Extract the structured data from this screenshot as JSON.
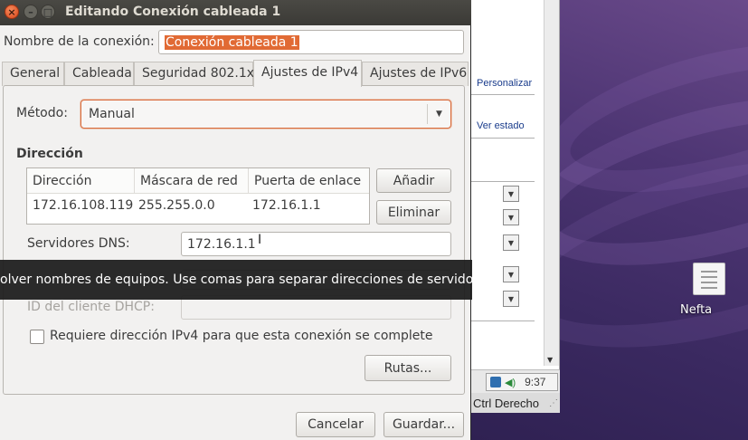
{
  "dialog": {
    "title": "Editando Conexión cableada 1",
    "connection_name_label": "Nombre de la conexión:",
    "connection_name_value": "Conexión cableada 1",
    "tabs": [
      {
        "label": "General"
      },
      {
        "label": "Cableada"
      },
      {
        "label": "Seguridad 802.1x"
      },
      {
        "label": "Ajustes de IPv4"
      },
      {
        "label": "Ajustes de IPv6"
      }
    ],
    "active_tab": "Ajustes de IPv4",
    "method_label": "Método:",
    "method_value": "Manual",
    "address_section_title": "Dirección",
    "address_table": {
      "columns": [
        "Dirección",
        "Máscara de red",
        "Puerta de enlace"
      ],
      "rows": [
        [
          "172.16.108.119",
          "255.255.0.0",
          "172.16.1.1"
        ]
      ]
    },
    "add_button": "Añadir",
    "delete_button": "Eliminar",
    "dns_label": "Servidores DNS:",
    "dns_value": "172.16.1.1",
    "tooltip": "olver nombres de equipos. Use comas para separar direcciones de servidores",
    "dhcp_client_id_label": "ID del cliente DHCP:",
    "require_ipv4_label": "Requiere dirección IPv4 para que esta conexión se complete",
    "require_ipv4_checked": false,
    "routes_button": "Rutas...",
    "cancel_button": "Cancelar",
    "save_button": "Guardar..."
  },
  "background_window": {
    "link_customize": "Personalizar",
    "link_view_status": "Ver estado",
    "clock": "9:37",
    "host_key": "Ctrl Derecho"
  },
  "desktop": {
    "icon_label": "Nefta"
  },
  "colors": {
    "selection": "#e16a34",
    "titlebar": "#3c3b37",
    "close_button": "#e0562a"
  }
}
